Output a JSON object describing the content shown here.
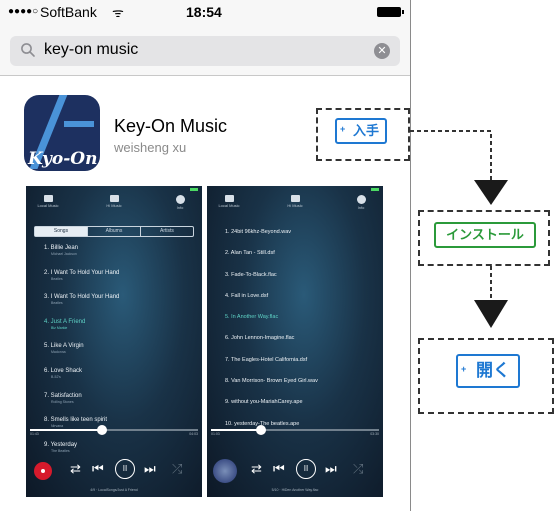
{
  "status_bar": {
    "signal": "●●●●○",
    "carrier": "SoftBank",
    "wifi": "ᯤ",
    "time": "18:54"
  },
  "search": {
    "query": "key-on music",
    "clear": "✕"
  },
  "app": {
    "icon_text": "Kyo-On",
    "name": "Key-On Music",
    "developer": "weisheng xu"
  },
  "screenshot1": {
    "tabs_top": [
      "Local Music",
      "Hi Music",
      "Info"
    ],
    "segments": [
      "Songs",
      "Albums",
      "Artists"
    ],
    "songs": [
      {
        "title": "1. Billie Jean",
        "artist": "Michael Jackson"
      },
      {
        "title": "2. I Want To Hold Your Hand",
        "artist": "Beatles"
      },
      {
        "title": "3. I Want To Hold Your Hand",
        "artist": "Beatles"
      },
      {
        "title": "4. Just A Friend",
        "artist": "Biz Markie"
      },
      {
        "title": "5. Like A Virgin",
        "artist": "Madonna"
      },
      {
        "title": "6. Love Shack",
        "artist": "B-52's"
      },
      {
        "title": "7. Satisfaction",
        "artist": "Rolling Stones"
      },
      {
        "title": "8. Smells like teen spirit",
        "artist": "Nirvana"
      },
      {
        "title": "9. Yesterday",
        "artist": "The Beatles"
      }
    ],
    "time_left": "01:43",
    "time_right": "04:03",
    "now_playing": "4/9 · LocalSongs/Just A Friend"
  },
  "screenshot2": {
    "tabs_top": [
      "Local Music",
      "Hi Music",
      "Info"
    ],
    "tracks": [
      "1. 24bit 96khz-Beyond.wav",
      "2. Alan Tan - Still.dsf",
      "3. Fade-To-Black.flac",
      "4. Fall in Love.dsf",
      "5. In Another Way.flac",
      "6. John Lennon-Imagine.flac",
      "7. The Eagles-Hotel California.dsf",
      "8. Van Morrison- Brown Eyed Girl.wav",
      "9. without you-MariahCarey.ape",
      "10. yesterday-The beatles.ape"
    ],
    "time_left": "01:03",
    "time_right": "03:30",
    "now_playing": "5/10 · HiDen Another Way.flac"
  },
  "controls": {
    "repeat": "⇄",
    "prev": "⏮",
    "play": "II",
    "next": "⏭",
    "shuffle": "⤮"
  },
  "steps": {
    "get": {
      "plus": "+",
      "label": "入手"
    },
    "install": {
      "label": "インストール"
    },
    "open": {
      "plus": "+",
      "label": "開く"
    }
  },
  "colors": {
    "accent_blue": "#1e78d2",
    "accent_green": "#2b9a3a",
    "now_playing_teal": "#5fd3c6"
  },
  "playback": {
    "s1_progress": 0.43,
    "s2_progress": 0.3
  }
}
